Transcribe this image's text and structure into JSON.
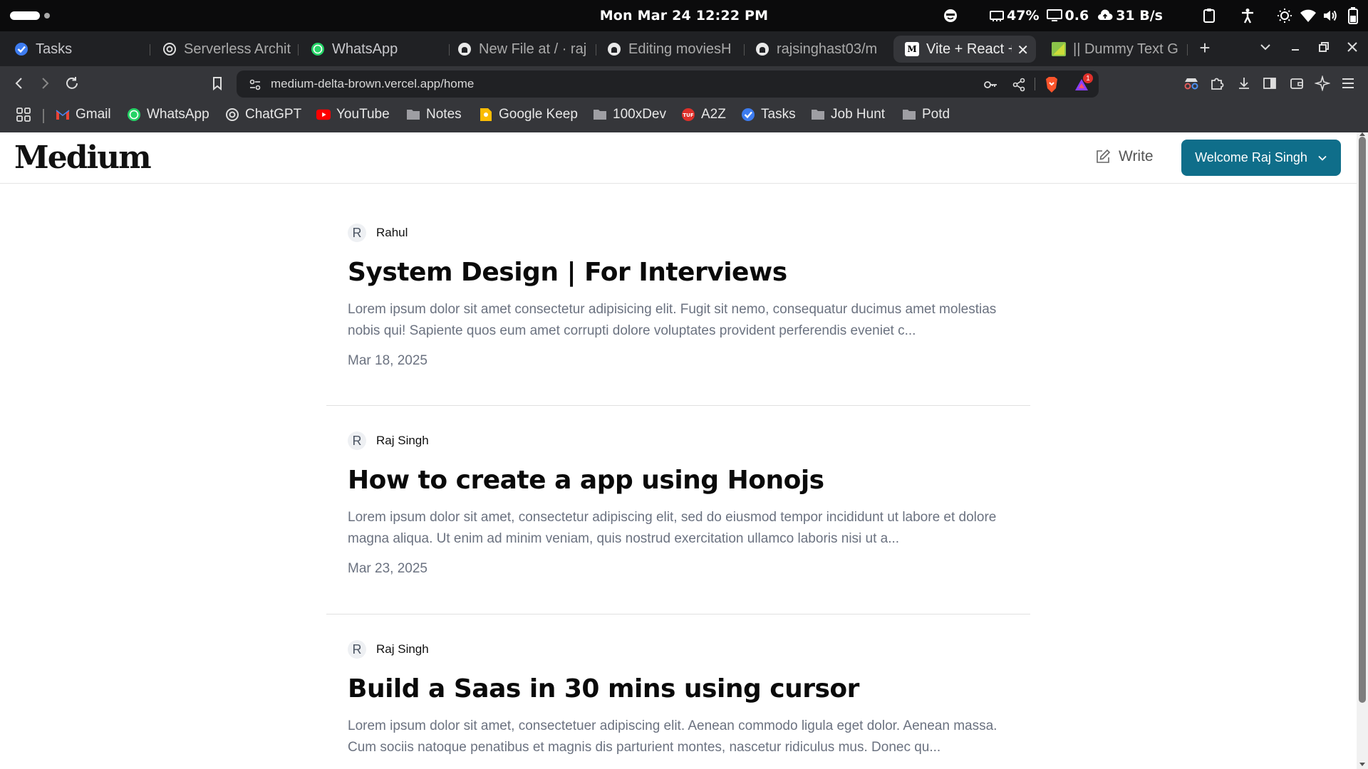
{
  "os": {
    "clock": "Mon Mar 24  12:22 PM",
    "battery": "47%",
    "display": "0.6",
    "network_speed": "31 B/s"
  },
  "tabs": [
    {
      "label": "Tasks",
      "icon": "tasks-icon"
    },
    {
      "label": "Serverless Archit",
      "icon": "chatgpt-icon"
    },
    {
      "label": "WhatsApp",
      "icon": "whatsapp-icon"
    },
    {
      "label": "New File at / · raj",
      "icon": "github-icon"
    },
    {
      "label": "Editing moviesH",
      "icon": "github-icon"
    },
    {
      "label": "rajsinghast03/m",
      "icon": "github-icon"
    },
    {
      "label": "Vite + React +",
      "icon": "medium-icon",
      "active": true
    },
    {
      "label": "|| Dummy Text G",
      "icon": "dummytext-icon"
    }
  ],
  "address_bar": {
    "url": "medium-delta-brown.vercel.app/home",
    "brave_badge": "1"
  },
  "bookmarks": [
    {
      "label": "Gmail",
      "icon": "gmail-icon"
    },
    {
      "label": "WhatsApp",
      "icon": "whatsapp-icon"
    },
    {
      "label": "ChatGPT",
      "icon": "chatgpt-icon"
    },
    {
      "label": "YouTube",
      "icon": "youtube-icon"
    },
    {
      "label": "Notes",
      "icon": "folder-icon"
    },
    {
      "label": "Google Keep",
      "icon": "keep-icon"
    },
    {
      "label": "100xDev",
      "icon": "folder-icon"
    },
    {
      "label": "A2Z",
      "icon": "tuf-icon"
    },
    {
      "label": "Tasks",
      "icon": "tasks-icon"
    },
    {
      "label": "Job Hunt",
      "icon": "folder-icon"
    },
    {
      "label": "Potd",
      "icon": "folder-icon"
    }
  ],
  "app": {
    "logo": "Medium",
    "write_label": "Write",
    "welcome_label": "Welcome Raj Singh",
    "brand_color": "#0f6e8a"
  },
  "posts": [
    {
      "avatar": "R",
      "author": "Rahul",
      "title": "System Design | For Interviews",
      "excerpt": "Lorem ipsum dolor sit amet consectetur adipisicing elit. Fugit sit nemo, consequatur ducimus amet molestias nobis qui! Sapiente quos eum amet corrupti dolore voluptates provident perferendis eveniet c...",
      "date": "Mar 18, 2025"
    },
    {
      "avatar": "R",
      "author": "Raj Singh",
      "title": "How to create a app using Honojs",
      "excerpt": "Lorem ipsum dolor sit amet, consectetur adipiscing elit, sed do eiusmod tempor incididunt ut labore et dolore magna aliqua. Ut enim ad minim veniam, quis nostrud exercitation ullamco laboris nisi ut a...",
      "date": "Mar 23, 2025"
    },
    {
      "avatar": "R",
      "author": "Raj Singh",
      "title": "Build a Saas in 30 mins using cursor",
      "excerpt": "Lorem ipsum dolor sit amet, consectetuer adipiscing elit. Aenean commodo ligula eget dolor. Aenean massa. Cum sociis natoque penatibus et magnis dis parturient montes, nascetur ridiculus mus. Donec qu...",
      "date": ""
    }
  ]
}
